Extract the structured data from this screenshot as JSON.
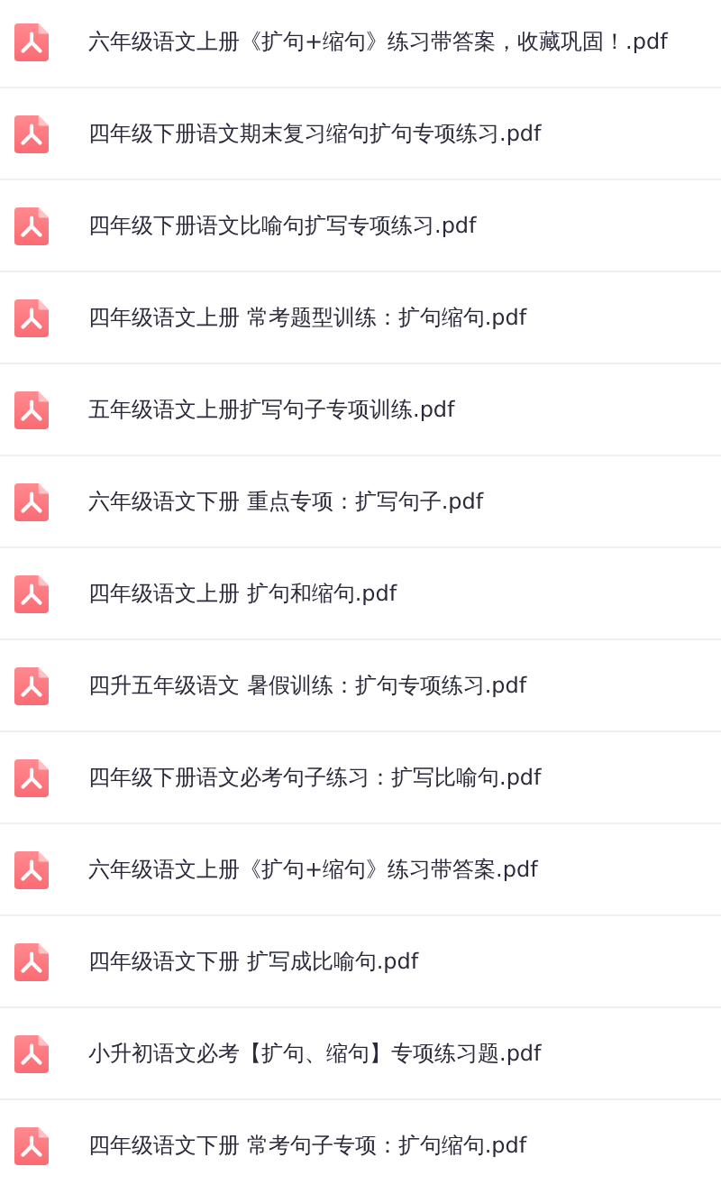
{
  "files": [
    {
      "name": "六年级语文上册《扩句+缩句》练习带答案，收藏巩固！.pdf",
      "kind": "pdf"
    },
    {
      "name": "四年级下册语文期末复习缩句扩句专项练习.pdf",
      "kind": "pdf"
    },
    {
      "name": "四年级下册语文比喻句扩写专项练习.pdf",
      "kind": "pdf"
    },
    {
      "name": "四年级语文上册 常考题型训练：扩句缩句.pdf",
      "kind": "pdf"
    },
    {
      "name": "五年级语文上册扩写句子专项训练.pdf",
      "kind": "pdf"
    },
    {
      "name": "六年级语文下册 重点专项：扩写句子.pdf",
      "kind": "pdf"
    },
    {
      "name": "四年级语文上册 扩句和缩句.pdf",
      "kind": "pdf"
    },
    {
      "name": "四升五年级语文 暑假训练：扩句专项练习.pdf",
      "kind": "pdf"
    },
    {
      "name": "四年级下册语文必考句子练习：扩写比喻句.pdf",
      "kind": "pdf"
    },
    {
      "name": "六年级语文上册《扩句+缩句》练习带答案.pdf",
      "kind": "pdf"
    },
    {
      "name": "四年级语文下册 扩写成比喻句.pdf",
      "kind": "pdf"
    },
    {
      "name": "小升初语文必考【扩句、缩句】专项练习题.pdf",
      "kind": "pdf"
    },
    {
      "name": "四年级语文下册 常考句子专项：扩句缩句.pdf",
      "kind": "pdf"
    }
  ]
}
